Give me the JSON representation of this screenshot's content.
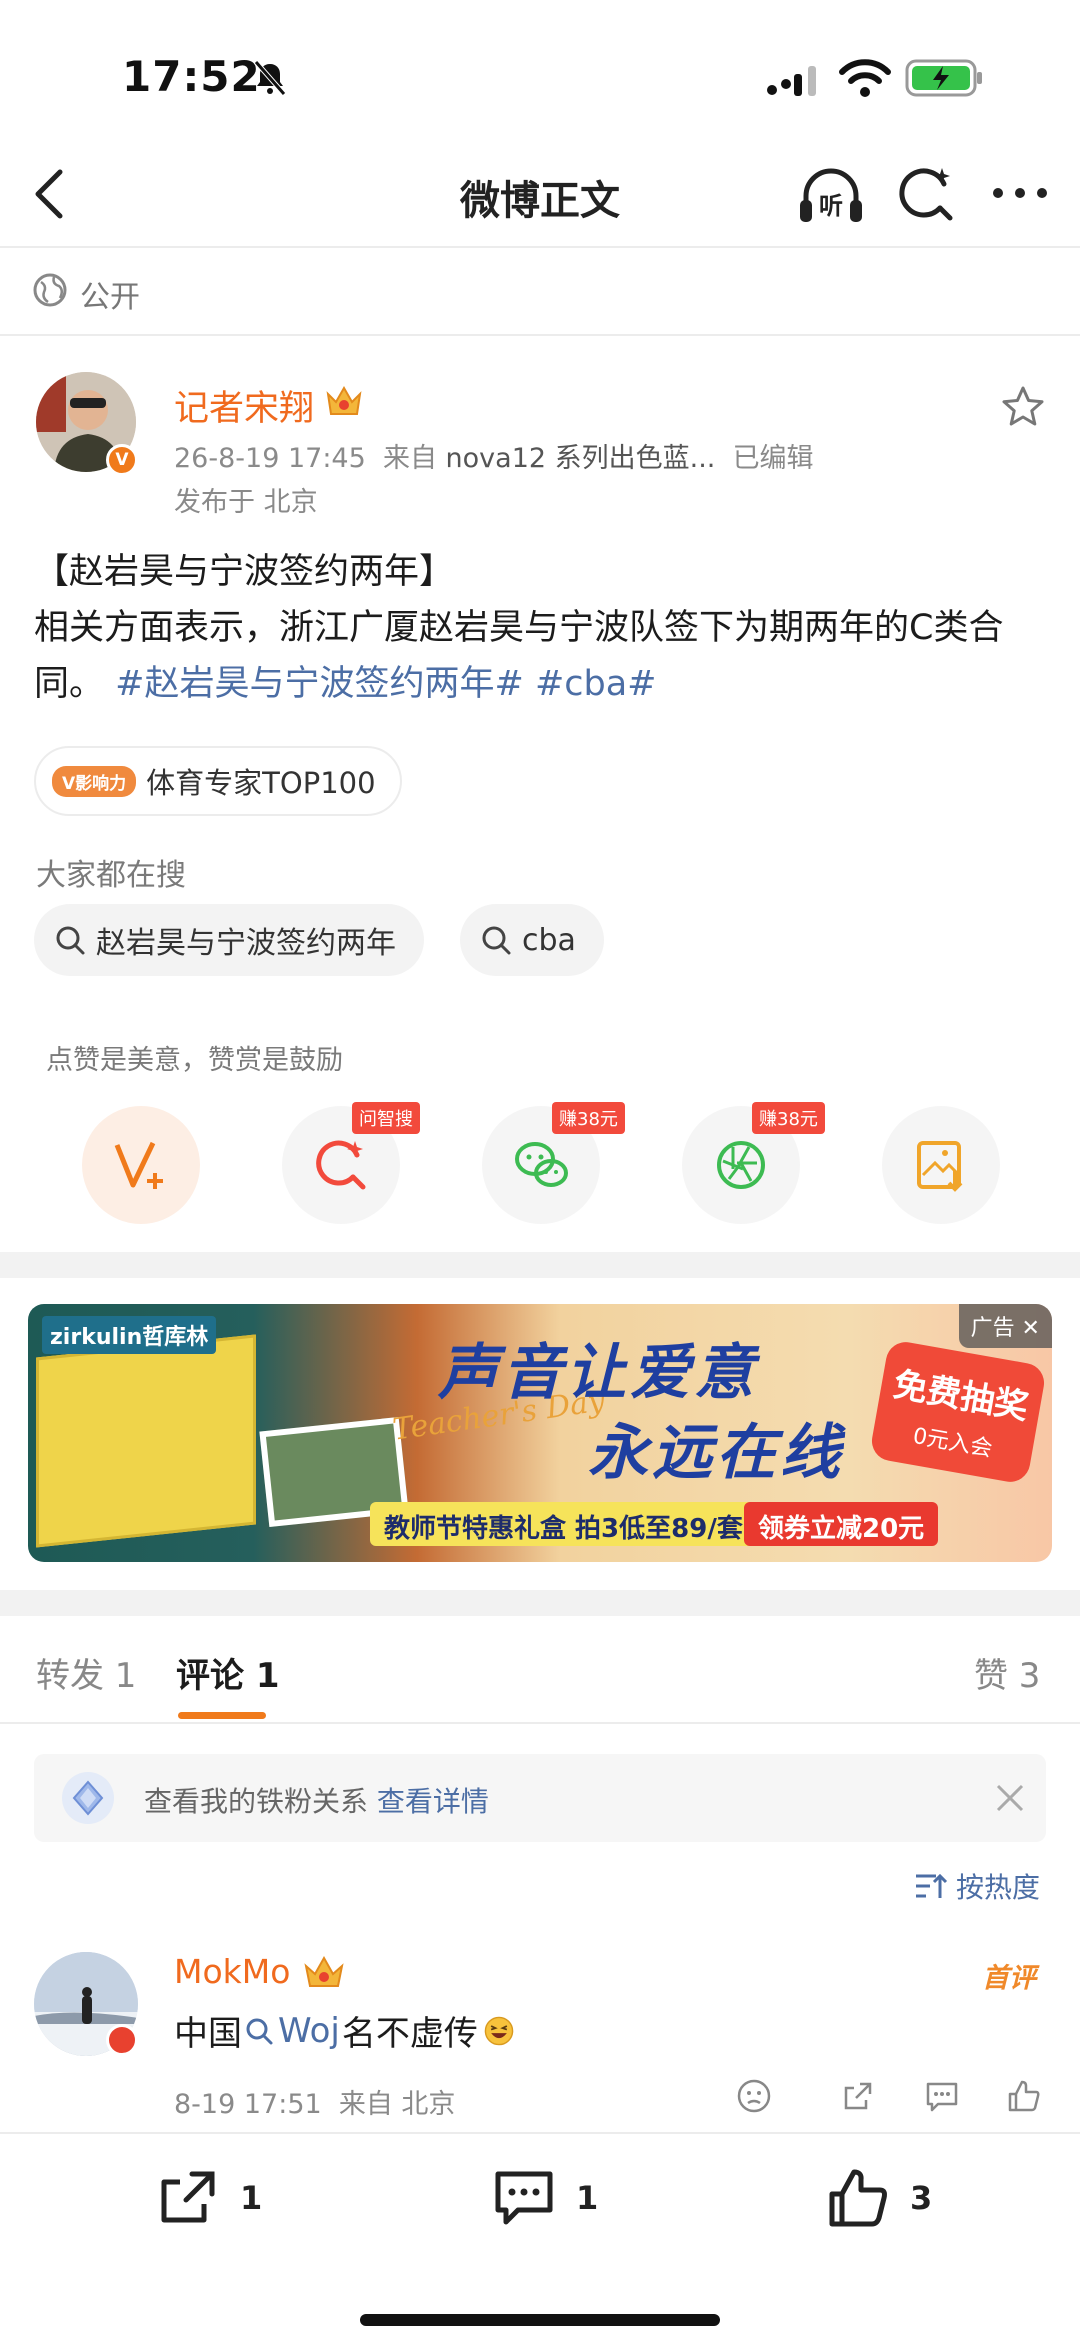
{
  "status_bar": {
    "time": "17:52"
  },
  "nav": {
    "title": "微博正文",
    "listen_icon": "headphones-listen-icon",
    "ai_icon": "ai-search-icon",
    "more_icon": "more-dots-icon"
  },
  "visibility": {
    "label": "公开"
  },
  "author": {
    "name": "记者宋翔",
    "badge": "V",
    "time": "26-8-19 17:45",
    "from_prefix": "来自",
    "device": "nova12 系列出色蓝...",
    "edited": "已编辑",
    "location": "发布于 北京"
  },
  "post": {
    "title": "【赵岩昊与宁波签约两年】",
    "body": "相关方面表示，浙江广厦赵岩昊与宁波队签下为期两年的C类合同。",
    "tags": [
      "#赵岩昊与宁波签约两年#",
      "#cba#"
    ]
  },
  "influence": {
    "badge": "V影响力",
    "label": "体育专家TOP100"
  },
  "hot_search": {
    "label": "大家都在搜",
    "chips": [
      "赵岩昊与宁波签约两年",
      "cba"
    ]
  },
  "reward": {
    "note": "点赞是美意，赞赏是鼓励",
    "actions": [
      {
        "name": "reward",
        "tip": ""
      },
      {
        "name": "ai-search",
        "tip": "问智搜"
      },
      {
        "name": "wechat",
        "tip": "赚38元"
      },
      {
        "name": "moments",
        "tip": "赚38元"
      },
      {
        "name": "save-image",
        "tip": ""
      }
    ]
  },
  "ad": {
    "brand": "zirkulin哲库林",
    "slogan_line1": "声音让爱意",
    "slogan_line2": "永远在线",
    "script": "Teacher's Day",
    "strip": "教师节特惠礼盒 拍3低至89/套",
    "coupon": "领券立减20元",
    "free_title": "免费抽奖",
    "free_sub": "0元入会",
    "label": "广告 ✕"
  },
  "tabs": {
    "repost": "转发 1",
    "comment": "评论 1",
    "like": "赞 3"
  },
  "fans_notice": {
    "text": "查看我的铁粉关系",
    "link": "查看详情"
  },
  "sort": {
    "label": "按热度"
  },
  "comment": {
    "user": "MokMo",
    "first_label": "首评",
    "text_before": "中国",
    "keyword": "Woj",
    "text_after": "名不虚传",
    "time": "8-19 17:51",
    "from": "来自 北京"
  },
  "bottom_bar": {
    "repost_count": "1",
    "comment_count": "1",
    "like_count": "3"
  },
  "colors": {
    "accent": "#f07a1b",
    "link": "#4c6ea5",
    "name": "#f06a1e",
    "tip": "#f24a3c"
  }
}
